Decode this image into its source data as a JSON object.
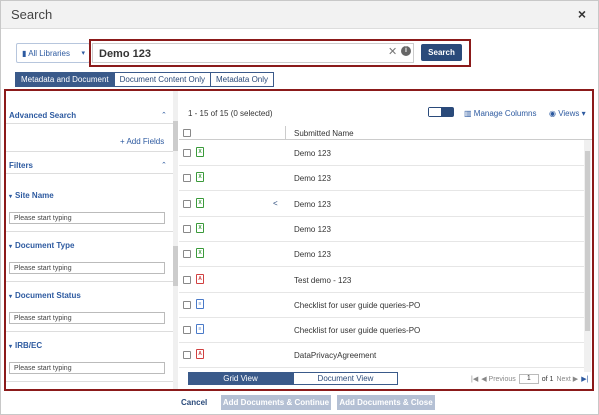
{
  "modal": {
    "title": "Search",
    "close_glyph": "×"
  },
  "search": {
    "library_label": "All Libraries",
    "library_caret": "▾",
    "query": "Demo 123",
    "clear_glyph": "✕",
    "info_glyph": "i",
    "button_label": "Search"
  },
  "modes": [
    {
      "label": "Metadata and Document",
      "active": true
    },
    {
      "label": "Document Content Only",
      "active": false
    },
    {
      "label": "Metadata Only",
      "active": false
    }
  ],
  "left_panel": {
    "advanced_search": "Advanced Search",
    "add_fields": "Add Fields",
    "add_glyph": "+",
    "filters": "Filters",
    "caret_up": "⌃",
    "field_triangle": "▾",
    "fields": [
      {
        "label": "Site Name",
        "placeholder": "Please start typing"
      },
      {
        "label": "Document Type",
        "placeholder": "Please start typing"
      },
      {
        "label": "Document Status",
        "placeholder": "Please start typing"
      },
      {
        "label": "IRB/EC",
        "placeholder": "Please start typing"
      }
    ]
  },
  "results": {
    "count_text": "1 - 15 of 15 (0 selected)",
    "manage_columns": "Manage Columns",
    "views": "Views",
    "column_header": "Submitted Name",
    "share_glyph": "<",
    "rows": [
      {
        "name": "Demo 123",
        "file_type": "xls",
        "shared": false
      },
      {
        "name": "Demo 123",
        "file_type": "xls",
        "shared": false
      },
      {
        "name": "Demo 123",
        "file_type": "xls",
        "shared": true
      },
      {
        "name": "Demo 123",
        "file_type": "xls",
        "shared": false
      },
      {
        "name": "Demo 123",
        "file_type": "xls",
        "shared": false
      },
      {
        "name": "Test demo - 123",
        "file_type": "pdf",
        "shared": false
      },
      {
        "name": "Checklist for user guide queries-PO",
        "file_type": "doc",
        "shared": false
      },
      {
        "name": "Checklist for user guide queries-PO",
        "file_type": "doc",
        "shared": false
      },
      {
        "name": "DataPrivacyAgreement",
        "file_type": "pdf",
        "shared": false
      }
    ],
    "icon_glyphs": {
      "xls": "X",
      "pdf": "A",
      "doc": "≡"
    },
    "grid_view": "Grid View",
    "document_view": "Document View",
    "pager": {
      "first": "|◀",
      "previous": "◀ Previous",
      "page": "1",
      "of": "of 1",
      "next": "Next ▶",
      "last": "▶|"
    }
  },
  "footer": {
    "cancel": "Cancel",
    "add_continue": "Add Documents & Continue",
    "add_close": "Add Documents & Close"
  }
}
